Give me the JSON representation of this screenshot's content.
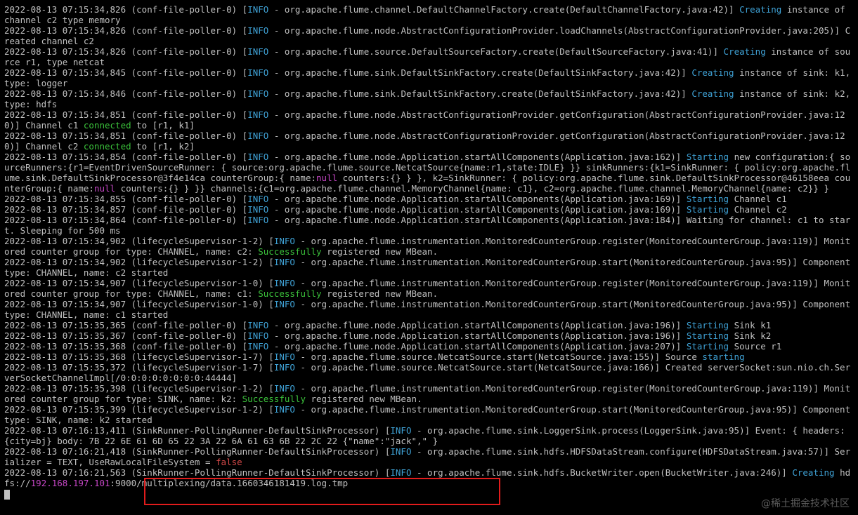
{
  "colors": {
    "background": "#000000",
    "text": "#c0c0c0",
    "info": "#3fa2d6",
    "green": "#3bc23b",
    "magenta": "#c546c5",
    "red": "#d84a4a",
    "highlight_box": "#e11c1c"
  },
  "watermark": "@稀土掘金技术社区",
  "log_lines": [
    [
      {
        "t": "2022-08-13 07:15:34,826 (conf-file-poller-0) ["
      },
      {
        "t": "INFO",
        "c": "info"
      },
      {
        "t": " - org.apache.flume.channel.DefaultChannelFactory.create(DefaultChannelFactory.java:42)] "
      },
      {
        "t": "Creating",
        "c": "info"
      },
      {
        "t": " instance of channel c2 type memory"
      }
    ],
    [
      {
        "t": "2022-08-13 07:15:34,826 (conf-file-poller-0) ["
      },
      {
        "t": "INFO",
        "c": "info"
      },
      {
        "t": " - org.apache.flume.node.AbstractConfigurationProvider.loadChannels(AbstractConfigurationProvider.java:205)] Created channel c2"
      }
    ],
    [
      {
        "t": "2022-08-13 07:15:34,826 (conf-file-poller-0) ["
      },
      {
        "t": "INFO",
        "c": "info"
      },
      {
        "t": " - org.apache.flume.source.DefaultSourceFactory.create(DefaultSourceFactory.java:41)] "
      },
      {
        "t": "Creating",
        "c": "info"
      },
      {
        "t": " instance of source r1, type netcat"
      }
    ],
    [
      {
        "t": "2022-08-13 07:15:34,845 (conf-file-poller-0) ["
      },
      {
        "t": "INFO",
        "c": "info"
      },
      {
        "t": " - org.apache.flume.sink.DefaultSinkFactory.create(DefaultSinkFactory.java:42)] "
      },
      {
        "t": "Creating",
        "c": "info"
      },
      {
        "t": " instance of sink: k1, type: logger"
      }
    ],
    [
      {
        "t": "2022-08-13 07:15:34,846 (conf-file-poller-0) ["
      },
      {
        "t": "INFO",
        "c": "info"
      },
      {
        "t": " - org.apache.flume.sink.DefaultSinkFactory.create(DefaultSinkFactory.java:42)] "
      },
      {
        "t": "Creating",
        "c": "info"
      },
      {
        "t": " instance of sink: k2, type: hdfs"
      }
    ],
    [
      {
        "t": "2022-08-13 07:15:34,851 (conf-file-poller-0) ["
      },
      {
        "t": "INFO",
        "c": "info"
      },
      {
        "t": " - org.apache.flume.node.AbstractConfigurationProvider.getConfiguration(AbstractConfigurationProvider.java:120)] Channel c1 "
      },
      {
        "t": "connected",
        "c": "green"
      },
      {
        "t": " to [r1, k1]"
      }
    ],
    [
      {
        "t": "2022-08-13 07:15:34,851 (conf-file-poller-0) ["
      },
      {
        "t": "INFO",
        "c": "info"
      },
      {
        "t": " - org.apache.flume.node.AbstractConfigurationProvider.getConfiguration(AbstractConfigurationProvider.java:120)] Channel c2 "
      },
      {
        "t": "connected",
        "c": "green"
      },
      {
        "t": " to [r1, k2]"
      }
    ],
    [
      {
        "t": "2022-08-13 07:15:34,854 (conf-file-poller-0) ["
      },
      {
        "t": "INFO",
        "c": "info"
      },
      {
        "t": " - org.apache.flume.node.Application.startAllComponents(Application.java:162)] "
      },
      {
        "t": "Starting",
        "c": "info"
      },
      {
        "t": " new configuration:{ sourceRunners:{r1=EventDrivenSourceRunner: { source:org.apache.flume.source.NetcatSource{name:r1,state:IDLE} }} sinkRunners:{k1=SinkRunner: { policy:org.apache.flume.sink.DefaultSinkProcessor@3f4e14ca counterGroup:{ name:"
      },
      {
        "t": "null",
        "c": "magenta"
      },
      {
        "t": " counters:{} } }, k2=SinkRunner: { policy:org.apache.flume.sink.DefaultSinkProcessor@46158eea counterGroup:{ name:"
      },
      {
        "t": "null",
        "c": "magenta"
      },
      {
        "t": " counters:{} } }} channels:{c1=org.apache.flume.channel.MemoryChannel{name: c1}, c2=org.apache.flume.channel.MemoryChannel{name: c2}} }"
      }
    ],
    [
      {
        "t": "2022-08-13 07:15:34,855 (conf-file-poller-0) ["
      },
      {
        "t": "INFO",
        "c": "info"
      },
      {
        "t": " - org.apache.flume.node.Application.startAllComponents(Application.java:169)] "
      },
      {
        "t": "Starting",
        "c": "info"
      },
      {
        "t": " Channel c1"
      }
    ],
    [
      {
        "t": "2022-08-13 07:15:34,857 (conf-file-poller-0) ["
      },
      {
        "t": "INFO",
        "c": "info"
      },
      {
        "t": " - org.apache.flume.node.Application.startAllComponents(Application.java:169)] "
      },
      {
        "t": "Starting",
        "c": "info"
      },
      {
        "t": " Channel c2"
      }
    ],
    [
      {
        "t": "2022-08-13 07:15:34,864 (conf-file-poller-0) ["
      },
      {
        "t": "INFO",
        "c": "info"
      },
      {
        "t": " - org.apache.flume.node.Application.startAllComponents(Application.java:184)] Waiting for channel: c1 to start. Sleeping for 500 ms"
      }
    ],
    [
      {
        "t": "2022-08-13 07:15:34,902 (lifecycleSupervisor-1-2) ["
      },
      {
        "t": "INFO",
        "c": "info"
      },
      {
        "t": " - org.apache.flume.instrumentation.MonitoredCounterGroup.register(MonitoredCounterGroup.java:119)] Monitored counter group for type: CHANNEL, name: c2: "
      },
      {
        "t": "Successfully",
        "c": "green"
      },
      {
        "t": " registered new MBean."
      }
    ],
    [
      {
        "t": "2022-08-13 07:15:34,902 (lifecycleSupervisor-1-2) ["
      },
      {
        "t": "INFO",
        "c": "info"
      },
      {
        "t": " - org.apache.flume.instrumentation.MonitoredCounterGroup.start(MonitoredCounterGroup.java:95)] Component type: CHANNEL, name: c2 started"
      }
    ],
    [
      {
        "t": "2022-08-13 07:15:34,907 (lifecycleSupervisor-1-0) ["
      },
      {
        "t": "INFO",
        "c": "info"
      },
      {
        "t": " - org.apache.flume.instrumentation.MonitoredCounterGroup.register(MonitoredCounterGroup.java:119)] Monitored counter group for type: CHANNEL, name: c1: "
      },
      {
        "t": "Successfully",
        "c": "green"
      },
      {
        "t": " registered new MBean."
      }
    ],
    [
      {
        "t": "2022-08-13 07:15:34,907 (lifecycleSupervisor-1-0) ["
      },
      {
        "t": "INFO",
        "c": "info"
      },
      {
        "t": " - org.apache.flume.instrumentation.MonitoredCounterGroup.start(MonitoredCounterGroup.java:95)] Component type: CHANNEL, name: c1 started"
      }
    ],
    [
      {
        "t": "2022-08-13 07:15:35,365 (conf-file-poller-0) ["
      },
      {
        "t": "INFO",
        "c": "info"
      },
      {
        "t": " - org.apache.flume.node.Application.startAllComponents(Application.java:196)] "
      },
      {
        "t": "Starting",
        "c": "info"
      },
      {
        "t": " Sink k1"
      }
    ],
    [
      {
        "t": "2022-08-13 07:15:35,367 (conf-file-poller-0) ["
      },
      {
        "t": "INFO",
        "c": "info"
      },
      {
        "t": " - org.apache.flume.node.Application.startAllComponents(Application.java:196)] "
      },
      {
        "t": "Starting",
        "c": "info"
      },
      {
        "t": " Sink k2"
      }
    ],
    [
      {
        "t": "2022-08-13 07:15:35,368 (conf-file-poller-0) ["
      },
      {
        "t": "INFO",
        "c": "info"
      },
      {
        "t": " - org.apache.flume.node.Application.startAllComponents(Application.java:207)] "
      },
      {
        "t": "Starting",
        "c": "info"
      },
      {
        "t": " Source r1"
      }
    ],
    [
      {
        "t": "2022-08-13 07:15:35,368 (lifecycleSupervisor-1-7) ["
      },
      {
        "t": "INFO",
        "c": "info"
      },
      {
        "t": " - org.apache.flume.source.NetcatSource.start(NetcatSource.java:155)] Source "
      },
      {
        "t": "starting",
        "c": "info"
      }
    ],
    [
      {
        "t": "2022-08-13 07:15:35,372 (lifecycleSupervisor-1-7) ["
      },
      {
        "t": "INFO",
        "c": "info"
      },
      {
        "t": " - org.apache.flume.source.NetcatSource.start(NetcatSource.java:166)] Created serverSocket:sun.nio.ch.ServerSocketChannelImpl[/0:0:0:0:0:0:0:0:44444]"
      }
    ],
    [
      {
        "t": "2022-08-13 07:15:35,398 (lifecycleSupervisor-1-2) ["
      },
      {
        "t": "INFO",
        "c": "info"
      },
      {
        "t": " - org.apache.flume.instrumentation.MonitoredCounterGroup.register(MonitoredCounterGroup.java:119)] Monitored counter group for type: SINK, name: k2: "
      },
      {
        "t": "Successfully",
        "c": "green"
      },
      {
        "t": " registered new MBean."
      }
    ],
    [
      {
        "t": "2022-08-13 07:15:35,399 (lifecycleSupervisor-1-2) ["
      },
      {
        "t": "INFO",
        "c": "info"
      },
      {
        "t": " - org.apache.flume.instrumentation.MonitoredCounterGroup.start(MonitoredCounterGroup.java:95)] Component type: SINK, name: k2 started"
      }
    ],
    [
      {
        "t": "2022-08-13 07:16:13,411 (SinkRunner-PollingRunner-DefaultSinkProcessor) ["
      },
      {
        "t": "INFO",
        "c": "info"
      },
      {
        "t": " - org.apache.flume.sink.LoggerSink.process(LoggerSink.java:95)] Event: { headers:{city=bj} body: 7B 22 6E 61 6D 65 22 3A 22 6A 61 63 6B 22 2C 22 {\"name\":\"jack\",\" }"
      }
    ],
    [
      {
        "t": "2022-08-13 07:16:21,418 (SinkRunner-PollingRunner-DefaultSinkProcessor) ["
      },
      {
        "t": "INFO",
        "c": "info"
      },
      {
        "t": " - org.apache.flume.sink.hdfs.HDFSDataStream.configure(HDFSDataStream.java:57)] Serializer = TEXT, UseRawLocalFileSystem = "
      },
      {
        "t": "false",
        "c": "red"
      }
    ],
    [
      {
        "t": "2022-08-13 07:16:21,563 (SinkRunner-PollingRunner-DefaultSinkProcessor) ["
      },
      {
        "t": "INFO",
        "c": "info"
      },
      {
        "t": " - org.apache.flume.sink.hdfs.BucketWriter.open(BucketWriter.java:246)] "
      },
      {
        "t": "Creating",
        "c": "info"
      },
      {
        "t": " hdfs://"
      },
      {
        "t": "192.168.197.101",
        "c": "magenta"
      },
      {
        "t": ":9000/multiplexing/data.1660346181419.log.tmp"
      }
    ]
  ]
}
